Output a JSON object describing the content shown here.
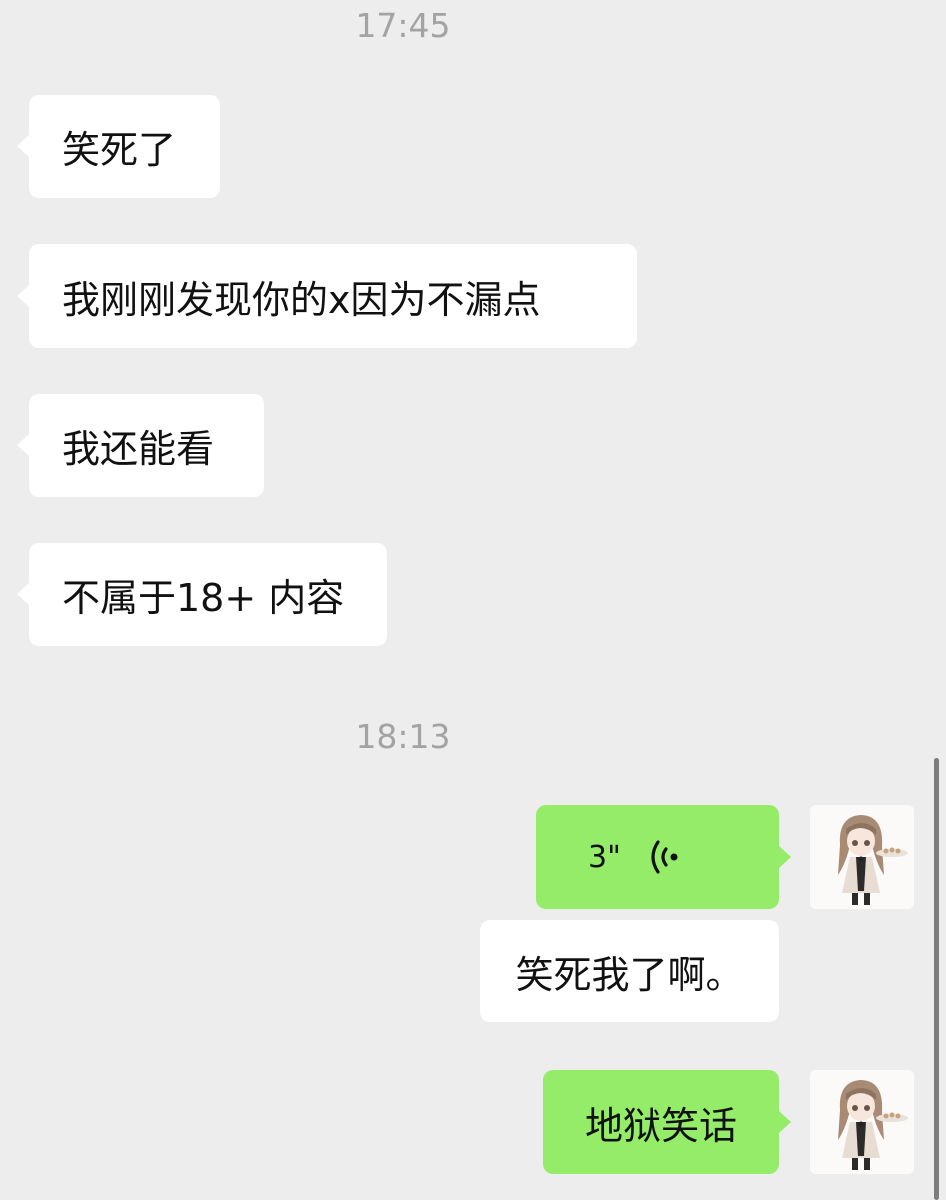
{
  "timestamps": [
    "17:45",
    "18:13"
  ],
  "incoming_messages": [
    "笑死了",
    "我刚刚发现你的x因为不漏点",
    "我还能看",
    "不属于18+ 内容"
  ],
  "outgoing": {
    "voice_duration": "3\"",
    "reply_text": "笑死我了啊。",
    "last_text": "地狱笑话"
  },
  "icons": {
    "voice": "voice-wave-icon",
    "avatar": "anime-girl-avatar"
  },
  "colors": {
    "background": "#ededed",
    "incoming_bubble": "#ffffff",
    "outgoing_bubble": "#95ec69",
    "timestamp": "#a3a3a3"
  }
}
